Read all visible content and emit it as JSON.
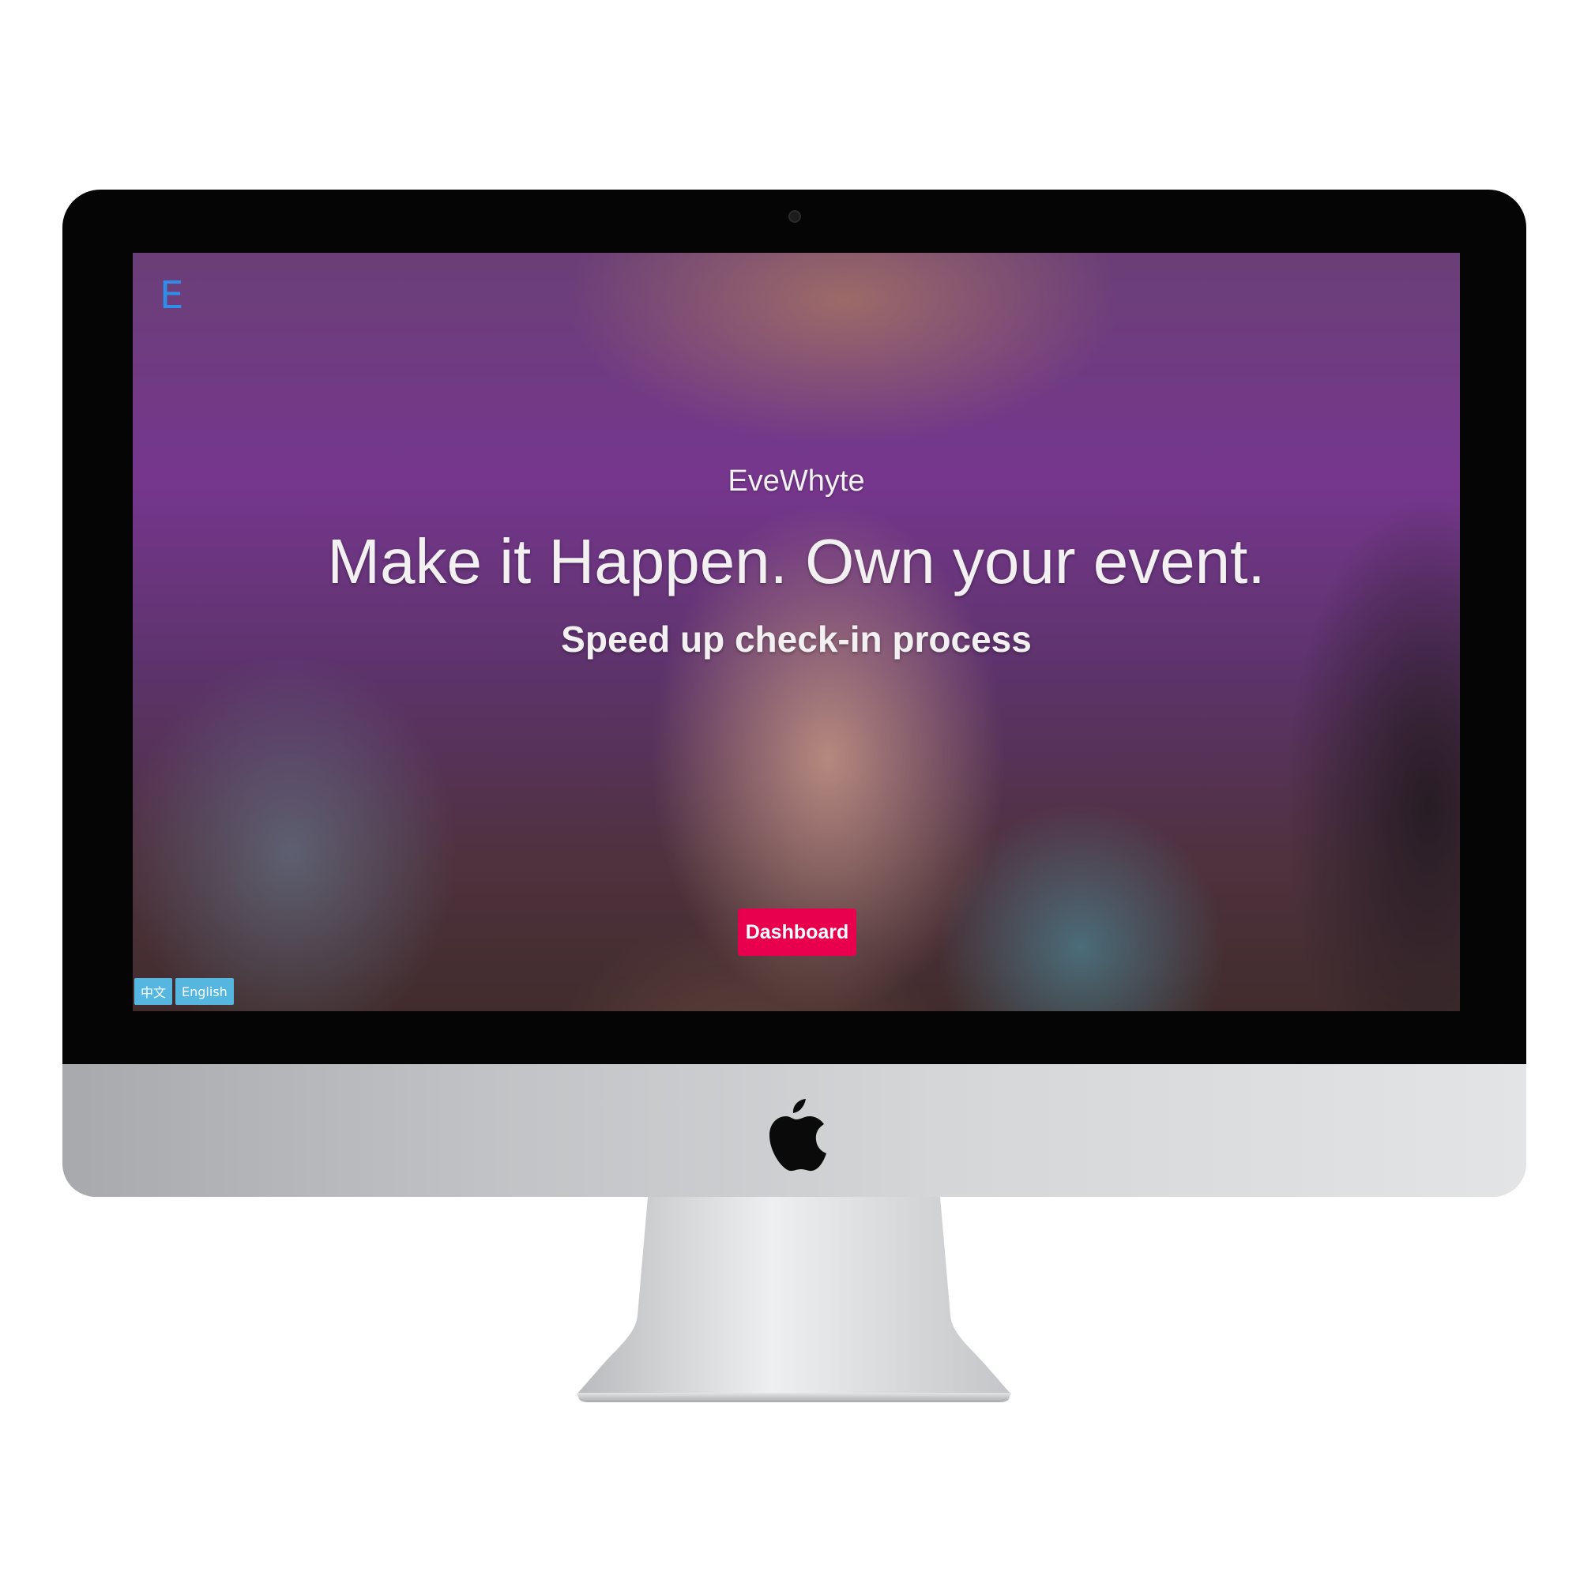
{
  "device": {
    "type": "imac",
    "brand_icon": "apple-logo-icon"
  },
  "site": {
    "logo_letter": "E",
    "brand_name": "EveWhyte",
    "headline": "Make it Happen. Own your event.",
    "subheadline": "Speed up check-in process",
    "cta_label": "Dashboard",
    "languages": [
      "中文",
      "English"
    ]
  },
  "colors": {
    "cta": "#e8004f",
    "logo": "#2f8fe8",
    "lang_buttons": "#55b6df"
  }
}
